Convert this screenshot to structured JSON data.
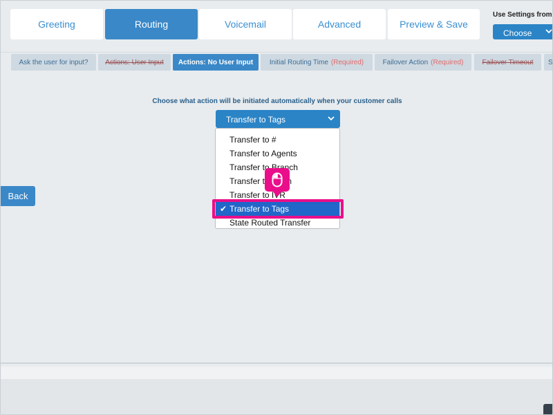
{
  "top_tabs": [
    {
      "label": "Greeting"
    },
    {
      "label": "Routing"
    },
    {
      "label": "Voicemail"
    },
    {
      "label": "Advanced"
    },
    {
      "label": "Preview & Save"
    }
  ],
  "settings": {
    "label": "Use Settings from",
    "select_value": "Choose"
  },
  "sub_tabs": [
    {
      "label": "Ask the user for input?",
      "req": ""
    },
    {
      "label": "Actions: User Input",
      "req": ""
    },
    {
      "label": "Actions: No User Input",
      "req": ""
    },
    {
      "label": "Initial Routing Time",
      "req": "(Required)"
    },
    {
      "label": "Failover Action",
      "req": "(Required)"
    },
    {
      "label": "Failover Timeout",
      "req": ""
    },
    {
      "label": "S",
      "req": ""
    }
  ],
  "prompt": "Choose what action will be initiated automatically when your customer calls",
  "dropdown": {
    "selected": "Transfer to Tags",
    "options": [
      "Transfer to #",
      "Transfer to Agents",
      "Transfer to Branch",
      "Transfer to Team",
      "Transfer to IVR",
      "Transfer to Tags",
      "State Routed Transfer"
    ],
    "check_mark": "✔"
  },
  "back_button": "Back",
  "colors": {
    "accent": "#3a88c8",
    "highlight": "#ea0e8a",
    "selected_option": "#2166c9"
  }
}
